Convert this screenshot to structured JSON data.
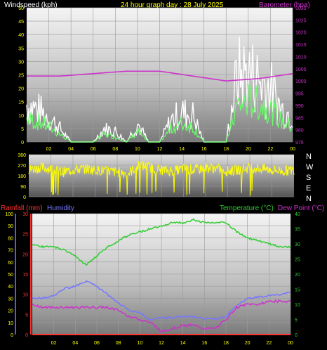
{
  "chart_data": [
    {
      "type": "line",
      "title": "24 hour graph day : 28 July 2025",
      "ylabel_left": "Windspeed (kph)",
      "ylabel_right": "Barometer (hpa)",
      "x_ticks": [
        "02",
        "04",
        "06",
        "08",
        "10",
        "12",
        "14",
        "16",
        "18",
        "20",
        "22",
        "00"
      ],
      "y_left_ticks": [
        "0",
        "5",
        "10",
        "15",
        "20",
        "25",
        "30",
        "35",
        "40",
        "45",
        "50"
      ],
      "y_left_range": [
        0,
        50
      ],
      "y_right_ticks": [
        "975",
        "980",
        "985",
        "990",
        "995",
        "1000",
        "1005",
        "1010",
        "1015",
        "1020",
        "1025",
        "1030"
      ],
      "y_right_range": [
        975,
        1030
      ],
      "grid": true,
      "series": [
        {
          "name": "Windspeed (kph)",
          "color": "#ffffff",
          "x": [
            0,
            1,
            2,
            3,
            4,
            5,
            6,
            7,
            8,
            9,
            10,
            11,
            12,
            13,
            14,
            15,
            16,
            17,
            18,
            19,
            20,
            21,
            22,
            23,
            24
          ],
          "values": [
            14,
            12,
            9,
            5,
            0,
            0,
            0,
            5,
            4,
            0,
            7,
            0,
            0,
            8,
            11,
            10,
            0,
            0,
            0,
            25,
            26,
            23,
            20,
            12,
            10
          ]
        },
        {
          "name": "Gust (kph)",
          "color": "#66ff66",
          "x": [
            0,
            1,
            2,
            3,
            4,
            5,
            6,
            7,
            8,
            9,
            10,
            11,
            12,
            13,
            14,
            15,
            16,
            17,
            18,
            19,
            20,
            21,
            22,
            23,
            24
          ],
          "values": [
            9,
            8,
            6,
            3,
            0,
            0,
            0,
            3,
            2,
            0,
            4,
            0,
            0,
            5,
            7,
            6,
            0,
            0,
            0,
            14,
            16,
            15,
            13,
            8,
            6
          ]
        },
        {
          "name": "Barometer (hpa)",
          "color": "#cc33cc",
          "x": [
            0,
            3,
            6,
            9,
            12,
            15,
            18,
            21,
            24
          ],
          "values": [
            1002,
            1002,
            1003,
            1004,
            1004,
            1002,
            1000,
            1001,
            1003
          ]
        }
      ]
    },
    {
      "type": "line",
      "ylabel_right": [
        "N",
        "W",
        "S",
        "E",
        "N"
      ],
      "y_left_ticks": [
        "360",
        "270",
        "180",
        "90",
        "0"
      ],
      "y_left_range": [
        0,
        360
      ],
      "series": [
        {
          "name": "Wind Direction",
          "color": "#ffff00",
          "x": [
            0,
            1,
            2,
            3,
            4,
            5,
            6,
            7,
            8,
            9,
            10,
            11,
            12,
            13,
            14,
            15,
            16,
            17,
            18,
            19,
            20,
            21,
            22,
            23,
            24
          ],
          "values": [
            230,
            250,
            240,
            210,
            230,
            240,
            230,
            220,
            210,
            200,
            270,
            250,
            230,
            220,
            240,
            230,
            250,
            240,
            220,
            230,
            250,
            240,
            230,
            220,
            230
          ]
        }
      ]
    },
    {
      "type": "line",
      "legend": [
        "Rainfall (mm)",
        "Humidity",
        "Temperature (°C)",
        "Dew Point (°C)"
      ],
      "x_ticks": [
        "02",
        "04",
        "06",
        "08",
        "10",
        "12",
        "14",
        "16",
        "18",
        "20",
        "22",
        "00"
      ],
      "y_humidity_ticks": [
        "0",
        "10",
        "20",
        "30",
        "40",
        "50",
        "60",
        "70",
        "80",
        "90",
        "100"
      ],
      "y_rain_ticks": [
        "0",
        "5",
        "10",
        "15",
        "20",
        "25",
        "30"
      ],
      "y_temp_ticks": [
        "0",
        "5",
        "10",
        "15",
        "20",
        "25",
        "30",
        "35",
        "40"
      ],
      "grid": true,
      "series": [
        {
          "name": "Temperature (°C)",
          "color": "#33cc33",
          "x": [
            0,
            1,
            2,
            3,
            4,
            5,
            6,
            7,
            8,
            9,
            10,
            11,
            12,
            13,
            14,
            15,
            16,
            17,
            18,
            19,
            20,
            21,
            22,
            23,
            24
          ],
          "values": [
            30,
            29,
            29,
            28,
            26,
            23,
            26,
            29,
            31,
            33,
            34,
            35,
            36,
            37,
            37,
            38,
            37,
            37,
            37,
            34,
            32,
            31,
            30,
            29,
            29
          ]
        },
        {
          "name": "Humidity",
          "color": "#7777ff",
          "x": [
            0,
            1,
            2,
            3,
            4,
            5,
            6,
            7,
            8,
            9,
            10,
            11,
            12,
            13,
            14,
            15,
            16,
            17,
            18,
            19,
            20,
            21,
            22,
            23,
            24
          ],
          "values": [
            30,
            30,
            32,
            38,
            40,
            44,
            40,
            33,
            26,
            20,
            18,
            12,
            14,
            14,
            15,
            15,
            13,
            13,
            15,
            24,
            30,
            31,
            32,
            33,
            35
          ]
        },
        {
          "name": "Dew Point (°C)",
          "color": "#cc33cc",
          "x": [
            0,
            1,
            2,
            3,
            4,
            5,
            6,
            7,
            8,
            9,
            10,
            11,
            12,
            13,
            14,
            15,
            16,
            17,
            18,
            19,
            20,
            21,
            22,
            23,
            24
          ],
          "values": [
            10,
            9,
            9,
            9,
            9,
            9,
            9,
            9,
            8,
            6,
            5,
            4,
            1,
            2,
            3,
            3,
            2,
            2,
            5,
            9,
            10,
            10,
            11,
            11,
            11
          ]
        },
        {
          "name": "Rainfall (mm)",
          "color": "#ff3333",
          "x": [
            0,
            24
          ],
          "values": [
            0,
            0
          ]
        }
      ]
    }
  ],
  "colors": {
    "windspeed_label": "#ffffff",
    "title": "#ffff00",
    "barometer_label": "#cc33cc",
    "rain_label": "#ff3333",
    "humidity_label": "#7777ff",
    "temp_label": "#33cc33",
    "dew_label": "#cc33cc",
    "axis_text": "#ffff00"
  }
}
